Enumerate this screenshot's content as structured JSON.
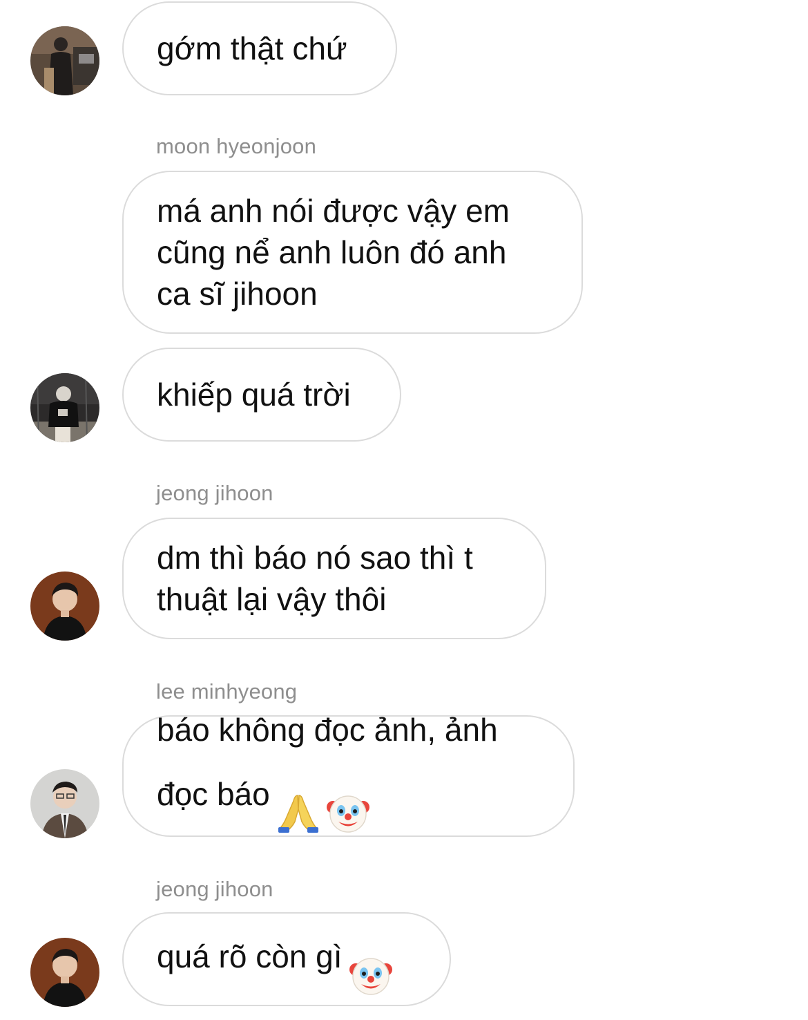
{
  "messages": [
    {
      "text": "gớm thật chứ"
    },
    {
      "sender": "moon hyeonjoon",
      "text": "má anh nói được vậy em\ncũng nể anh luôn đó anh\nca sĩ jihoon"
    },
    {
      "text": "khiếp quá trời"
    },
    {
      "sender": "jeong jihoon",
      "text": "dm thì báo nó sao thì t\nthuật lại vậy thôi"
    },
    {
      "sender": "lee minhyeong",
      "text": "báo không đọc ảnh, ảnh\nđọc báo",
      "emojis": [
        "folded-hands-emoji",
        "clown-face-emoji"
      ]
    },
    {
      "sender": "jeong jihoon",
      "text": "quá rõ còn gì",
      "emojis": [
        "clown-face-emoji"
      ]
    }
  ],
  "avatars": [
    "avatar-photo-dark-room",
    "avatar-photo-night-street",
    "avatar-photo-portrait-dark",
    "avatar-photo-portrait-suit",
    "avatar-photo-portrait-dark"
  ],
  "colors": {
    "bubble_border": "#dbdbdb",
    "sender_text": "#8e8e8e",
    "message_text": "#111111",
    "background": "#ffffff"
  }
}
